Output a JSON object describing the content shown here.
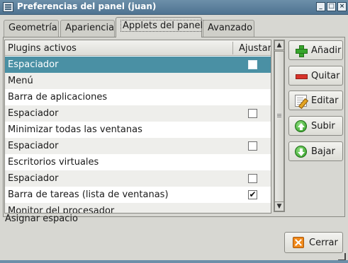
{
  "window": {
    "title": "Preferencias del panel (juan)",
    "controls": [
      "_",
      "□",
      "×"
    ]
  },
  "tabs": [
    {
      "label": "Geometría",
      "active": false
    },
    {
      "label": "Apariencia",
      "active": false
    },
    {
      "label": "Applets del panel",
      "active": true
    },
    {
      "label": "Avanzado",
      "active": false
    }
  ],
  "list": {
    "headers": {
      "plugin": "Plugins activos",
      "expand": "Ajustar"
    },
    "rows": [
      {
        "label": "Espaciador",
        "has_check": true,
        "checked": false,
        "selected": true
      },
      {
        "label": "Menú",
        "has_check": false,
        "checked": false,
        "selected": false
      },
      {
        "label": "Barra de aplicaciones",
        "has_check": false,
        "checked": false,
        "selected": false
      },
      {
        "label": "Espaciador",
        "has_check": true,
        "checked": false,
        "selected": false
      },
      {
        "label": "Minimizar todas las ventanas",
        "has_check": false,
        "checked": false,
        "selected": false
      },
      {
        "label": "Espaciador",
        "has_check": true,
        "checked": false,
        "selected": false
      },
      {
        "label": "Escritorios virtuales",
        "has_check": false,
        "checked": false,
        "selected": false
      },
      {
        "label": "Espaciador",
        "has_check": true,
        "checked": false,
        "selected": false
      },
      {
        "label": "Barra de tareas (lista de ventanas)",
        "has_check": true,
        "checked": true,
        "selected": false
      },
      {
        "label": "Monitor del procesador",
        "has_check": false,
        "checked": false,
        "selected": false
      }
    ]
  },
  "side_buttons": [
    {
      "label": "Añadir",
      "icon": "plus-icon"
    },
    {
      "label": "Quitar",
      "icon": "minus-icon"
    },
    {
      "label": "Editar",
      "icon": "edit-icon"
    },
    {
      "label": "Subir",
      "icon": "up-arrow-icon"
    },
    {
      "label": "Bajar",
      "icon": "down-arrow-icon"
    }
  ],
  "status": "Asignar espacio",
  "close_button": {
    "label": "Cerrar",
    "icon": "close-icon"
  },
  "colors": {
    "selection": "#4a90a4",
    "titlebar": "#4f7391"
  }
}
